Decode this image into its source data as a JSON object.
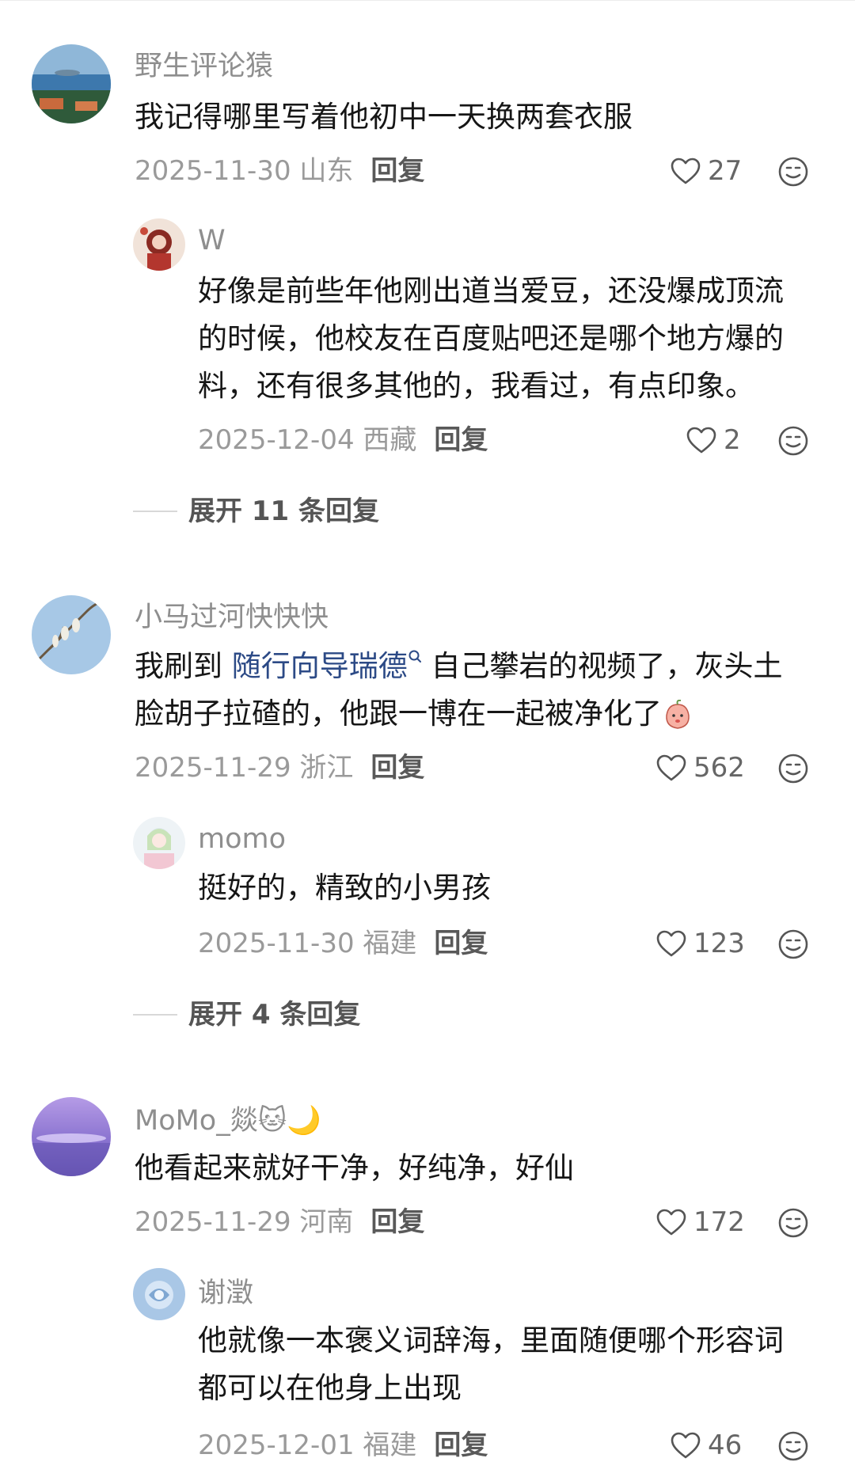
{
  "comments": [
    {
      "username": "野生评论猿",
      "text": "我记得哪里写着他初中一天换两套衣服",
      "date_location": "2025-11-30 山东",
      "reply_label": "回复",
      "likes": "27",
      "reply": {
        "username": "W",
        "text": "好像是前些年他刚出道当爱豆，还没爆成顶流的时候，他校友在百度贴吧还是哪个地方爆的料，还有很多其他的，我看过，有点印象。",
        "date_location": "2025-12-04 西藏",
        "reply_label": "回复",
        "likes": "2"
      },
      "expand_label": "展开 11 条回复"
    },
    {
      "username": "小马过河快快快",
      "text_before": "我刷到 ",
      "link_text": "随行向导瑞德",
      "text_after": " 自己攀岩的视频了，灰头土脸胡子拉碴的，他跟一博在一起被净化了",
      "date_location": "2025-11-29 浙江",
      "reply_label": "回复",
      "likes": "562",
      "reply": {
        "username": "momo",
        "text": "挺好的，精致的小男孩",
        "date_location": "2025-11-30 福建",
        "reply_label": "回复",
        "likes": "123"
      },
      "expand_label": "展开 4 条回复"
    },
    {
      "username": "MoMo_燚🐱🌙",
      "text": "他看起来就好干净，好纯净，好仙",
      "date_location": "2025-11-29 河南",
      "reply_label": "回复",
      "likes": "172",
      "reply": {
        "username": "谢澂",
        "text": "他就像一本褒义词辞海，里面随便哪个形容词都可以在他身上出现",
        "date_location": "2025-12-01 福建",
        "reply_label": "回复",
        "likes": "46"
      }
    }
  ],
  "icons": {
    "like": "heart-outline-icon",
    "react": "smiley-face-icon",
    "search": "search-icon",
    "inline_emoji": "peach-emoji-icon"
  },
  "colors": {
    "username": "#8e8e8e",
    "link": "#2c4a86",
    "meta": "#9a9a9a"
  }
}
